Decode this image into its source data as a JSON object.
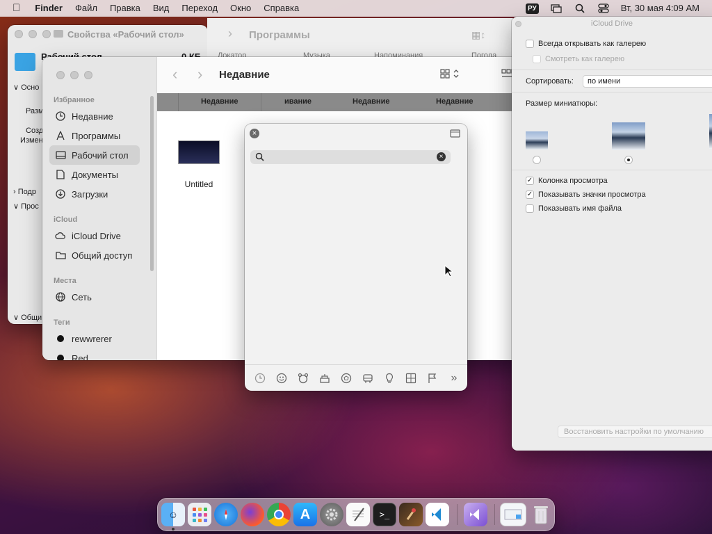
{
  "menubar": {
    "finder": "Finder",
    "items": [
      "Файл",
      "Правка",
      "Вид",
      "Переход",
      "Окно",
      "Справка"
    ],
    "input_source": "РУ",
    "datetime": "Вт, 30 мая  4:09 AM"
  },
  "props_window": {
    "title": "Свойства «Рабочий стол»",
    "name": "Рабочий стол",
    "size": "0 КБ",
    "rows": [
      "Осно",
      "Разм",
      "Созд",
      "Измен",
      "Подр",
      "Прос",
      "Общи"
    ]
  },
  "programs_window": {
    "title": "Программы",
    "cols": [
      "Локатор",
      "Музыка",
      "Напоминания",
      "Погода"
    ]
  },
  "finder": {
    "title": "Недавние",
    "favorites_header": "Избранное",
    "favorites": [
      "Недавние",
      "Программы",
      "Рабочий стол",
      "Документы",
      "Загрузки"
    ],
    "icloud_header": "iCloud",
    "icloud": [
      "iCloud Drive",
      "Общий доступ"
    ],
    "places_header": "Места",
    "places": [
      "Сеть"
    ],
    "tags_header": "Теги",
    "tags": [
      "rewwrerer",
      "Red"
    ],
    "columns": [
      "Недавние",
      "ивание",
      "Недавние",
      "Недавние"
    ],
    "file_name": "Untitled"
  },
  "emoji_picker": {
    "search_placeholder": "",
    "categories": [
      "clock",
      "smiley",
      "animal",
      "food",
      "sports",
      "travel",
      "objects",
      "symbols",
      "flags",
      "more"
    ]
  },
  "icloud_options": {
    "title": "iCloud Drive",
    "always_gallery": "Всегда открывать как галерею",
    "browse_gallery": "Смотреть как галерею",
    "sort_label": "Сортировать:",
    "sort_value": "по имени",
    "thumb_size_label": "Размер миниатюры:",
    "preview_column": "Колонка просмотра",
    "show_preview_icons": "Показывать значки просмотра",
    "show_filename": "Показывать имя файла",
    "restore": "Восстановить настройки по умолчанию"
  },
  "dock": {
    "apps": [
      "finder",
      "launchpad",
      "safari",
      "firefox",
      "chrome",
      "app-store",
      "system-settings",
      "textedit",
      "terminal",
      "instruments",
      "vscode",
      "visual-studio",
      "preview",
      "trash"
    ]
  }
}
